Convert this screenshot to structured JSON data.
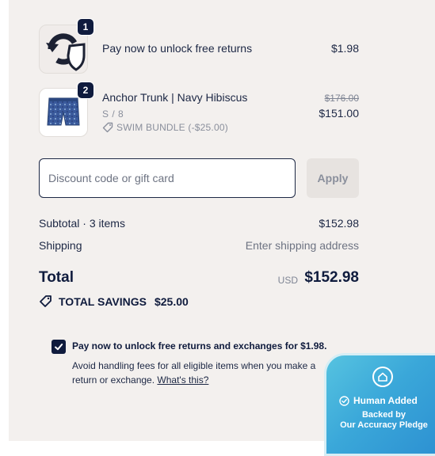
{
  "line_items": [
    {
      "quantity": "1",
      "title": "Pay now to unlock free returns",
      "price": "$1.98"
    },
    {
      "quantity": "2",
      "title": "Anchor Trunk | Navy Hibiscus",
      "variant": "S / 8",
      "discount_label": "SWIM BUNDLE (-$25.00)",
      "original_price": "$176.00",
      "price": "$151.00"
    }
  ],
  "discount": {
    "placeholder": "Discount code or gift card",
    "value": "",
    "apply_label": "Apply"
  },
  "summary": {
    "subtotal_label": "Subtotal · 3 items",
    "subtotal_value": "$152.98",
    "shipping_label": "Shipping",
    "shipping_value": "Enter shipping address",
    "total_label": "Total",
    "total_currency": "USD",
    "total_value": "$152.98",
    "savings_label": "TOTAL SAVINGS",
    "savings_value": "$25.00"
  },
  "returns_option": {
    "checked": true,
    "title": "Pay now to unlock free returns and exchanges for $1.98.",
    "description": "Avoid handling fees for all eligible items when you make a return or exchange.",
    "link_label": "What's this?"
  },
  "badge": {
    "title": "Human Added",
    "line1": "Backed by",
    "line2": "Our Accuracy Pledge"
  },
  "colors": {
    "navy": "#0f1b3d",
    "panel_bg": "#f3f0ee",
    "badge_blue": "#3aa7d9"
  }
}
